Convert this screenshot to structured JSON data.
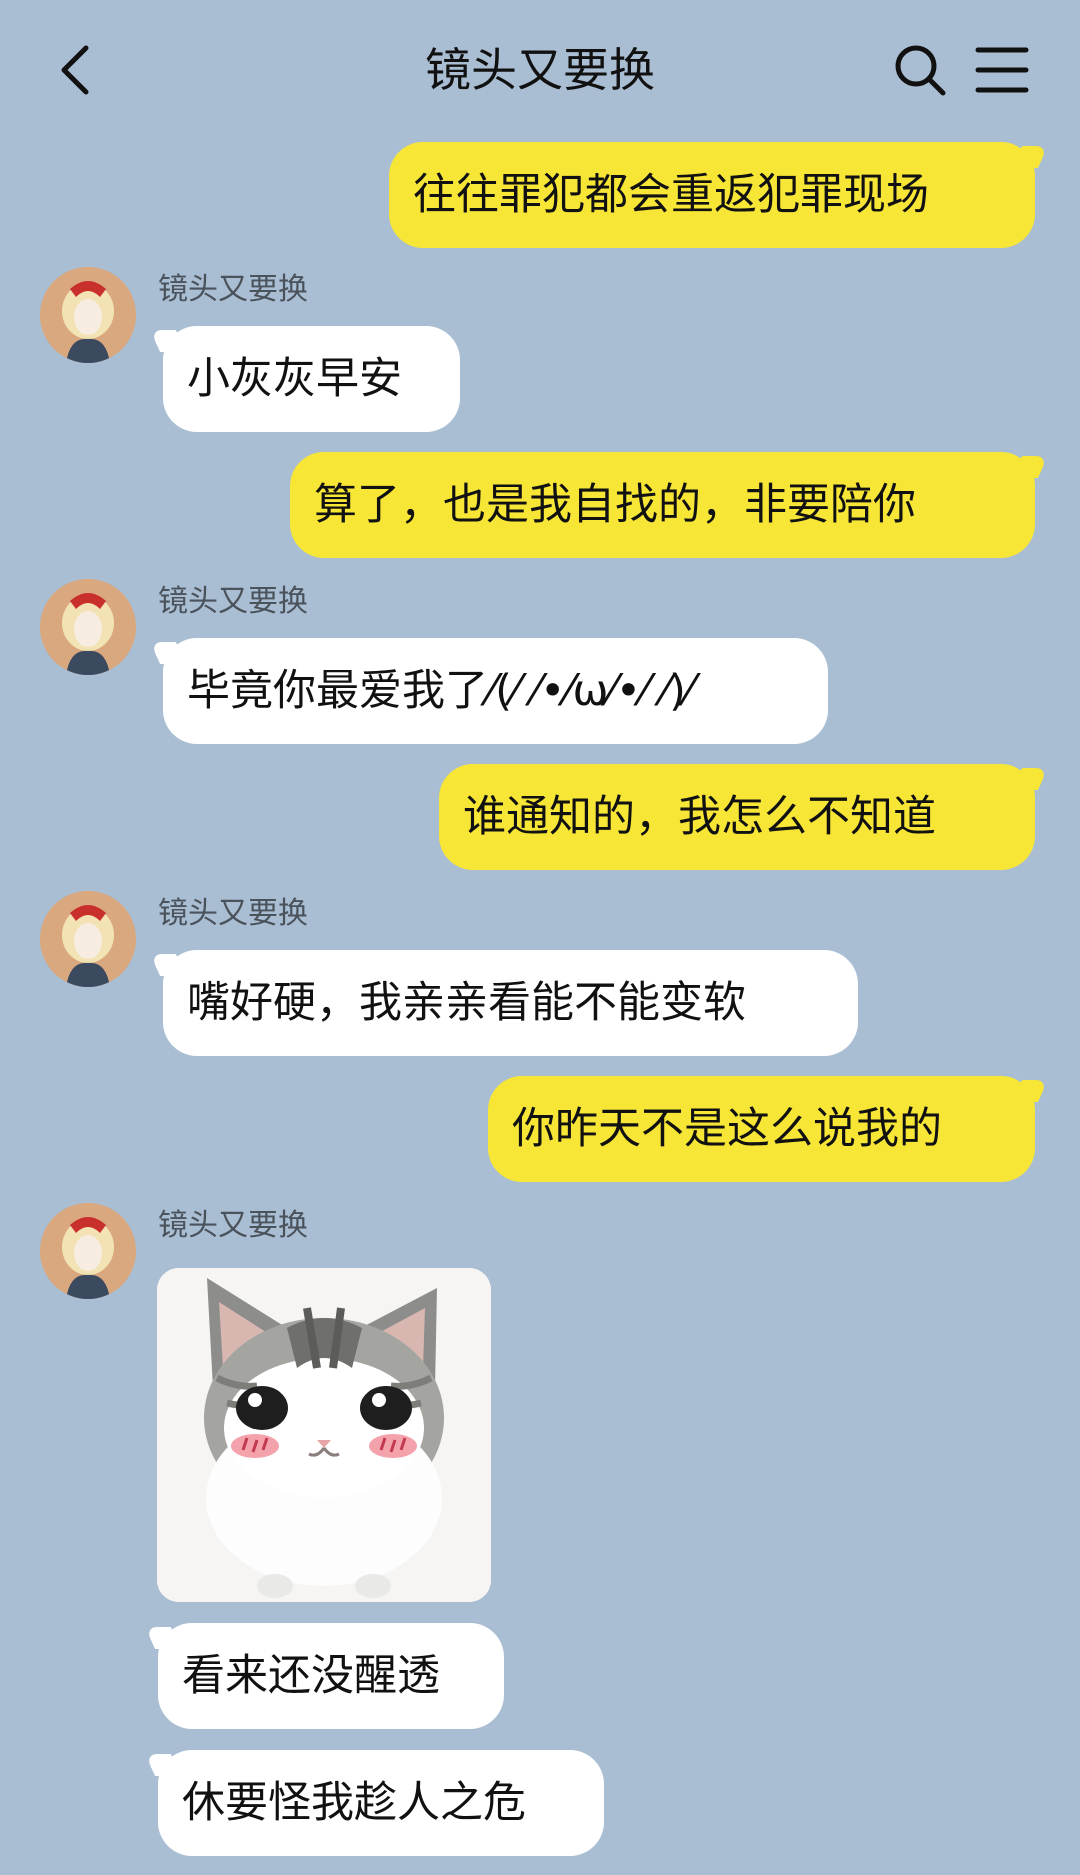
{
  "header": {
    "title": "镜头又要换",
    "back_icon": "chevron-left-icon",
    "search_icon": "search-icon",
    "menu_icon": "menu-icon"
  },
  "colors": {
    "background": "#a9bed3",
    "outgoing_bubble": "#f8e637",
    "incoming_bubble": "#ffffff"
  },
  "messages": [
    {
      "direction": "out",
      "text": "往往罪犯都会重返犯罪现场"
    },
    {
      "direction": "in",
      "sender": "镜头又要换",
      "text": "小灰灰早安"
    },
    {
      "direction": "out",
      "text": "算了，也是我自找的，非要陪你"
    },
    {
      "direction": "in",
      "sender": "镜头又要换",
      "text": "毕竟你最爱我了⁄(⁄ ⁄•⁄ω⁄•⁄ ⁄)⁄"
    },
    {
      "direction": "out",
      "text": "谁通知的，我怎么不知道"
    },
    {
      "direction": "in",
      "sender": "镜头又要换",
      "text": "嘴好硬，我亲亲看能不能变软"
    },
    {
      "direction": "out",
      "text": "你昨天不是这么说我的"
    },
    {
      "direction": "in",
      "sender": "镜头又要换",
      "sticker": "cat-sticker"
    },
    {
      "direction": "in",
      "text": "看来还没醒透"
    },
    {
      "direction": "in",
      "text": "休要怪我趁人之危"
    }
  ]
}
